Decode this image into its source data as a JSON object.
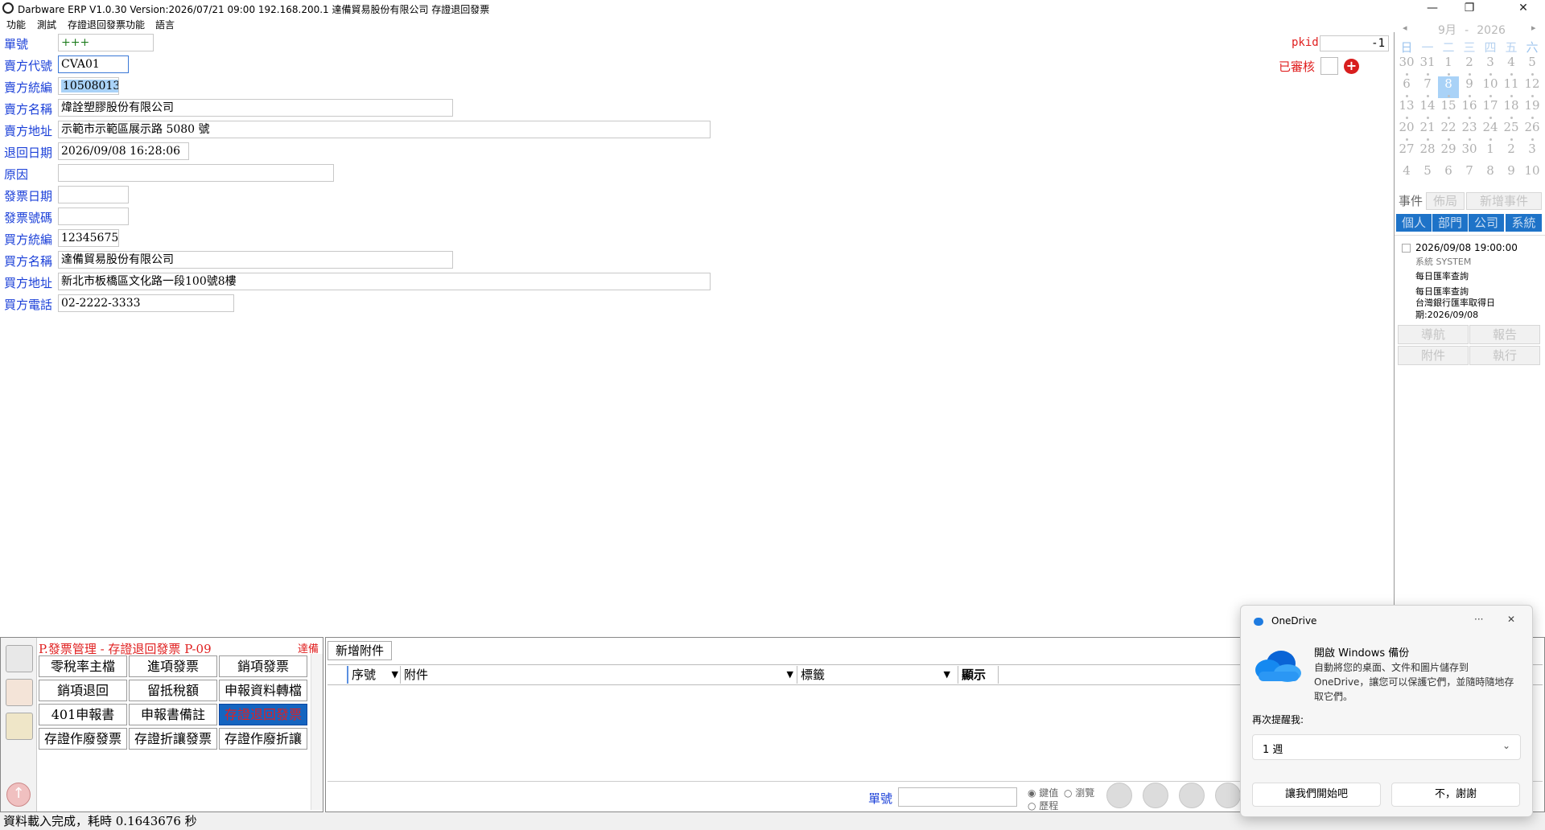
{
  "window": {
    "title": "Darbware ERP V1.0.30 Version:2026/07/21 09:00   192.168.200.1 達備貿易股份有限公司 存證退回發票",
    "minimize": "—",
    "restore": "❐",
    "close": "✕"
  },
  "menu": [
    "功能",
    "測試",
    "存證退回發票功能",
    "語言"
  ],
  "form": {
    "fields": [
      {
        "label": "單號",
        "value": "+++"
      },
      {
        "label": "賣方代號",
        "value": "CVA01"
      },
      {
        "label": "賣方統編",
        "value": "10508013"
      },
      {
        "label": "賣方名稱",
        "value": "煒詮塑膠股份有限公司"
      },
      {
        "label": "賣方地址",
        "value": "示範市示範區展示路 5080 號"
      },
      {
        "label": "退回日期",
        "value": "2026/09/08 16:28:06"
      },
      {
        "label": "原因",
        "value": ""
      },
      {
        "label": "發票日期",
        "value": ""
      },
      {
        "label": "發票號碼",
        "value": ""
      },
      {
        "label": "買方統編",
        "value": "12345675"
      },
      {
        "label": "買方名稱",
        "value": "達備貿易股份有限公司"
      },
      {
        "label": "買方地址",
        "value": "新北市板橋區文化路一段100號8樓"
      },
      {
        "label": "買方電話",
        "value": "02-2222-3333"
      }
    ],
    "pkid_label": "pkid",
    "pkid_value": "-1",
    "approved_label": "已審核",
    "add_icon": "plus-circle-icon"
  },
  "calendar": {
    "prev": "◂",
    "next": "▸",
    "month": "9月",
    "sep": "-",
    "year": "2026",
    "weekdays": [
      "日",
      "一",
      "二",
      "三",
      "四",
      "五",
      "六"
    ],
    "weeks": [
      [
        "30",
        "31",
        "1",
        "2",
        "3",
        "4",
        "5"
      ],
      [
        "6",
        "7",
        "8",
        "9",
        "10",
        "11",
        "12"
      ],
      [
        "13",
        "14",
        "15",
        "16",
        "17",
        "18",
        "19"
      ],
      [
        "20",
        "21",
        "22",
        "23",
        "24",
        "25",
        "26"
      ],
      [
        "27",
        "28",
        "29",
        "30",
        "1",
        "2",
        "3"
      ],
      [
        "4",
        "5",
        "6",
        "7",
        "8",
        "9",
        "10"
      ]
    ],
    "selected_day": "8"
  },
  "events": {
    "tab_label": "事件",
    "layout_btn": "佈局",
    "add_event_btn": "新增事件",
    "scopes": [
      "個人",
      "部門",
      "公司",
      "系統"
    ],
    "item": {
      "datetime": "2026/09/08 19:00:00",
      "owner": "系統  SYSTEM",
      "title": "每日匯率查詢",
      "subtitle": "每日匯率查詢",
      "desc": "台灣銀行匯率取得日期:2026/09/08"
    },
    "actions": [
      "導航",
      "報告",
      "附件",
      "執行"
    ]
  },
  "module": {
    "title": "P.發票管理 - 存證退回發票  P-09",
    "company": "達備",
    "buttons": [
      "零稅率主檔",
      "進項發票",
      "銷項發票",
      "銷項退回",
      "留抵稅額",
      "申報資料轉檔",
      "401申報書",
      "申報書備註",
      "存證退回發票",
      "存證作廢發票",
      "存證折讓發票",
      "存證作廢折讓"
    ],
    "active_index": 8
  },
  "attachments": {
    "add_btn": "新增附件",
    "columns": [
      "序號",
      "附件",
      "標籤",
      "顯示"
    ],
    "search_label": "單號",
    "radio_options": [
      "鍵值",
      "瀏覽",
      "歷程"
    ]
  },
  "status": "資料載入完成，耗時 0.1643676 秒",
  "onedrive": {
    "app": "OneDrive",
    "more": "···",
    "close": "✕",
    "heading": "開啟 Windows 備份",
    "body": "自動將您的桌面、文件和圖片儲存到 OneDrive，讓您可以保護它們，並隨時隨地存取它們。",
    "remind_label": "再次提醒我:",
    "remind_value": "1 週",
    "start_btn": "讓我們開始吧",
    "decline_btn": "不，謝謝"
  },
  "colors": {
    "label_blue": "#1a3fd8",
    "red": "#e02020",
    "active_blue": "#1565c0",
    "tab_blue": "#1e73c8"
  }
}
